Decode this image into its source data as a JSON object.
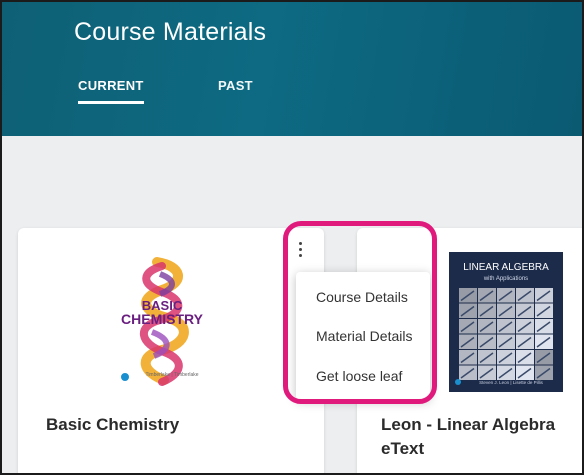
{
  "header": {
    "title": "Course Materials",
    "tabs": [
      {
        "label": "CURRENT",
        "active": true
      },
      {
        "label": "PAST",
        "active": false
      }
    ]
  },
  "cards": [
    {
      "title": "Basic Chemistry",
      "cover": {
        "line1": "BASIC",
        "line2": "CHEMISTRY",
        "authors": "Timberlake | Timberlake"
      }
    },
    {
      "title": "Leon - Linear Algebra eText",
      "cover": {
        "line1": "LINEAR ALGEBRA",
        "line2": "with Applications",
        "authors": "Steven J. Leon | Lisette de Pillis"
      }
    }
  ],
  "menu": {
    "items": [
      "Course Details",
      "Material Details",
      "Get loose leaf"
    ]
  },
  "colors": {
    "header": "#0d6a82",
    "highlight": "#e0197d",
    "background": "#eceef0"
  }
}
